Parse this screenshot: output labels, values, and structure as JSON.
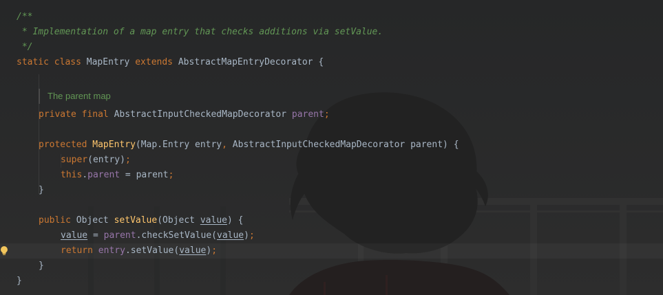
{
  "editor": {
    "lines": {
      "l1": "/**",
      "l2": " * Implementation of a map entry that checks additions via setValue.",
      "l3": " */",
      "l4_kw1": "static",
      "l4_kw2": "class",
      "l4_name": "MapEntry",
      "l4_kw3": "extends",
      "l4_super": "AbstractMapEntryDecorator",
      "l4_brace": "{",
      "doc_render": "The parent map",
      "l7_kw1": "private",
      "l7_kw2": "final",
      "l7_type": "AbstractInputCheckedMapDecorator",
      "l7_field": "parent",
      "l7_semi": ";",
      "l9_kw": "protected",
      "l9_name": "MapEntry",
      "l9_p1": "(Map.Entry entry",
      "l9_comma": ",",
      "l9_p2": " AbstractInputCheckedMapDecorator parent) {",
      "l10_kw": "super",
      "l10_rest": "(entry)",
      "l10_semi": ";",
      "l11_kw": "this",
      "l11_dot": ".",
      "l11_field": "parent",
      "l11_rest": " = parent",
      "l11_semi": ";",
      "l12": "}",
      "l14_kw": "public",
      "l14_type": " Object ",
      "l14_name": "setValue",
      "l14_p1": "(Object ",
      "l14_param": "value",
      "l14_p2": ") {",
      "l15_var": "value",
      "l15_eq": " = ",
      "l15_field": "parent",
      "l15_call": ".checkSetValue(",
      "l15_arg": "value",
      "l15_close": ")",
      "l15_semi": ";",
      "l16_kw": "return",
      "l16_field": "entry",
      "l16_call": ".setValue(",
      "l16_arg": "value",
      "l16_close": ")",
      "l16_semi": ";",
      "l17": "}",
      "l18": "}"
    }
  },
  "colors": {
    "background": "#2b2b2b",
    "keyword": "#cc7832",
    "doc_comment": "#629755",
    "function": "#ffc66d",
    "field": "#9876aa",
    "text": "#a9b7c6"
  },
  "icons": {
    "gutter": "lightbulb-icon"
  }
}
